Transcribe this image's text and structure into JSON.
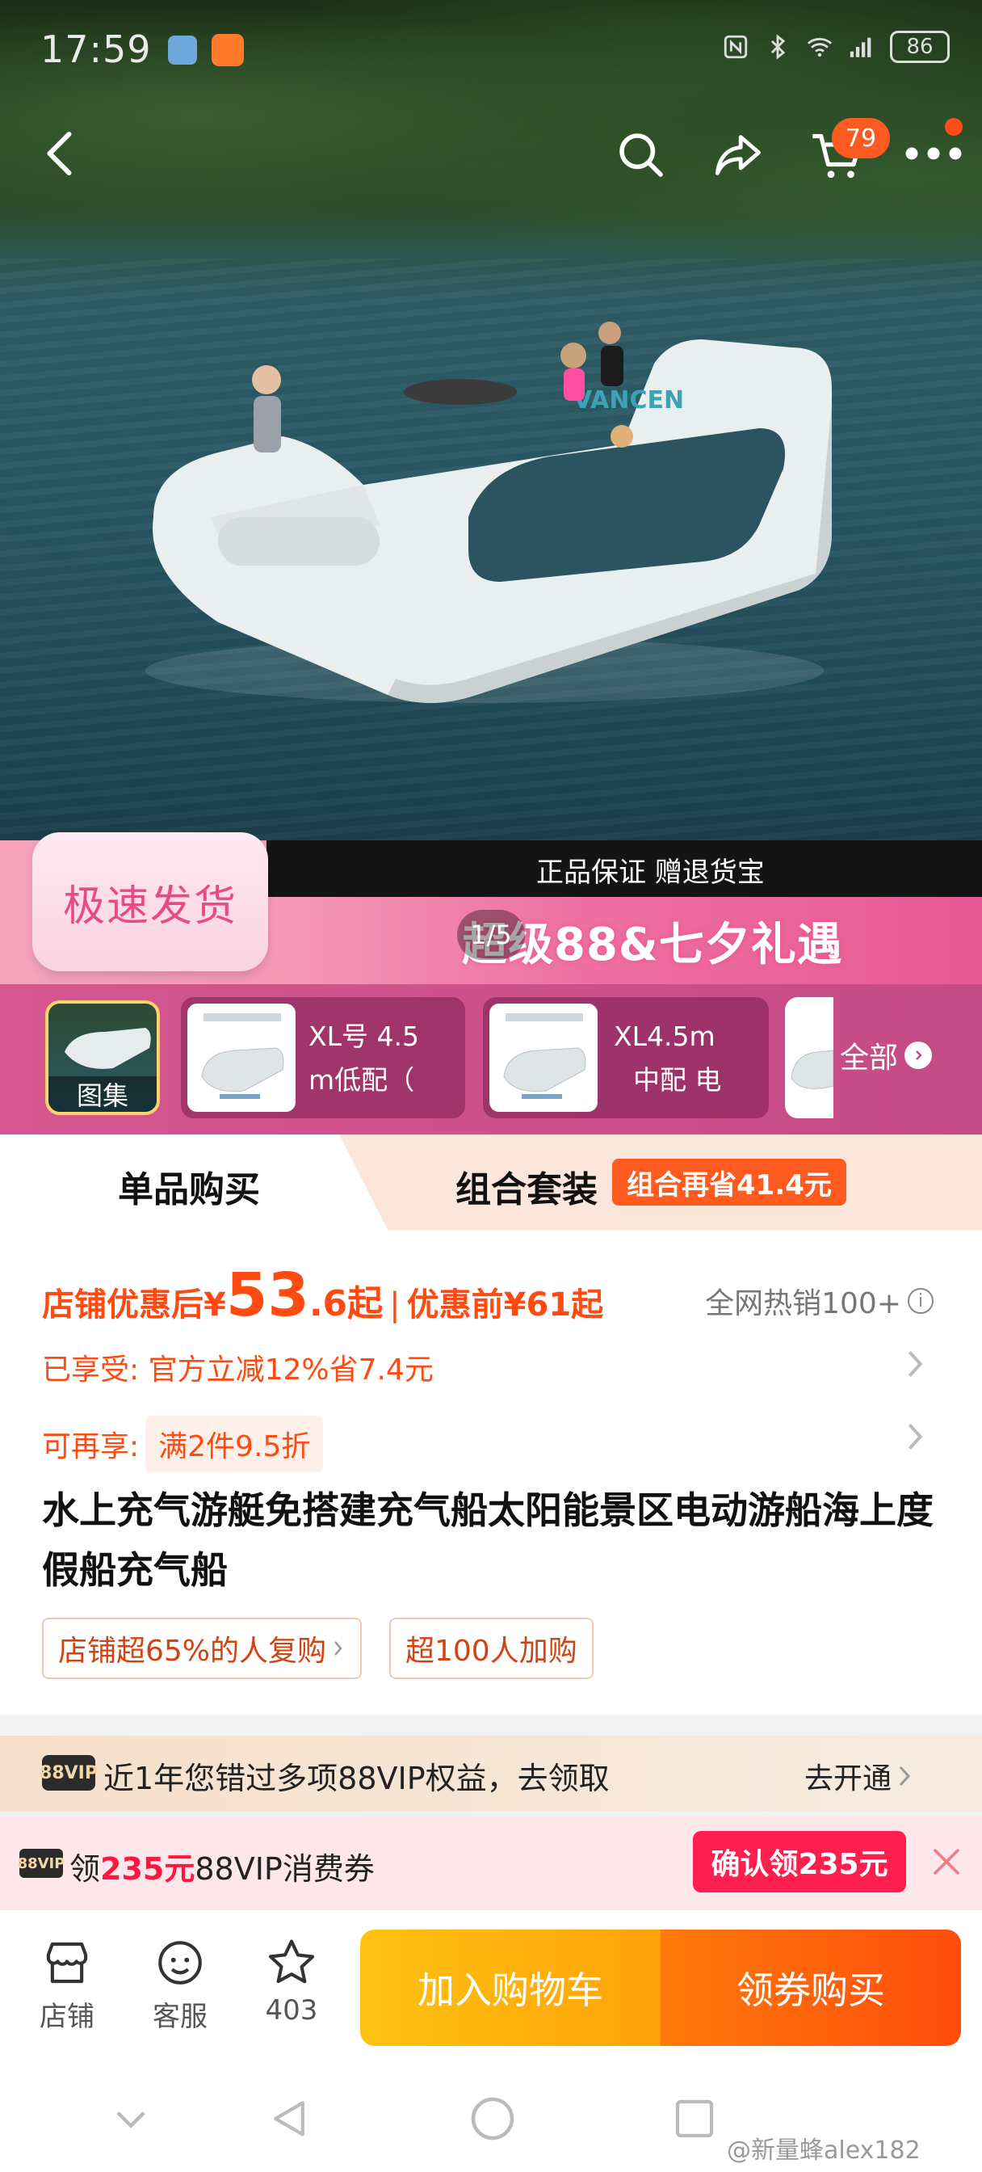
{
  "status_bar": {
    "time": "17:59",
    "battery": "86"
  },
  "header": {
    "cart_count": "79"
  },
  "hero": {
    "counter": "1/5",
    "brand": "VANCEN"
  },
  "promo": {
    "card": "极速发货",
    "guarantee": "正品保证 赠退货宝",
    "title": "超级88&七夕礼遇"
  },
  "thumbs": {
    "gallery_label": "图集",
    "items": [
      {
        "line1": "XL号 4.5",
        "line2": "m低配（"
      },
      {
        "line1": "XL4.5m",
        "line2": "中配 电"
      }
    ],
    "all_label": "全部"
  },
  "tabs": {
    "single": "单品购买",
    "combo": "组合套装",
    "combo_badge": "组合再省41.4元"
  },
  "price": {
    "prefix": "店铺优惠后",
    "yen": "¥",
    "integer": "53",
    "decimal": ".6起",
    "separator": "|",
    "before": "优惠前¥61起",
    "hot_sales": "全网热销100+",
    "info_icon": "i"
  },
  "enjoyed": "已享受: 官方立减12%省7.4元",
  "extra": {
    "label": "可再享:",
    "chip": "满2件9.5折"
  },
  "title": "水上充气游艇免搭建充气船太阳能景区电动游船海上度假船充气船",
  "tags": [
    "店铺超65%的人复购",
    "超100人加购"
  ],
  "vip1": {
    "badge": "88VIP",
    "text": "近1年您错过多项88VIP权益，去领取",
    "action": "去开通"
  },
  "vip2": {
    "badge": "88VIP",
    "prefix": "领",
    "amount": "235元",
    "suffix": "88VIP消费券",
    "button": "确认领235元"
  },
  "bottom_bar": {
    "shop": "店铺",
    "service": "客服",
    "favorites": "403",
    "add_cart": "加入购物车",
    "buy": "领券购买"
  },
  "watermark": "@新量蜂alex182",
  "colors": {
    "accent": "#ff4a12",
    "cart_button": "#ffb20e",
    "buy_button": "#ff5a0c",
    "vip_red": "#ff1f4f"
  }
}
